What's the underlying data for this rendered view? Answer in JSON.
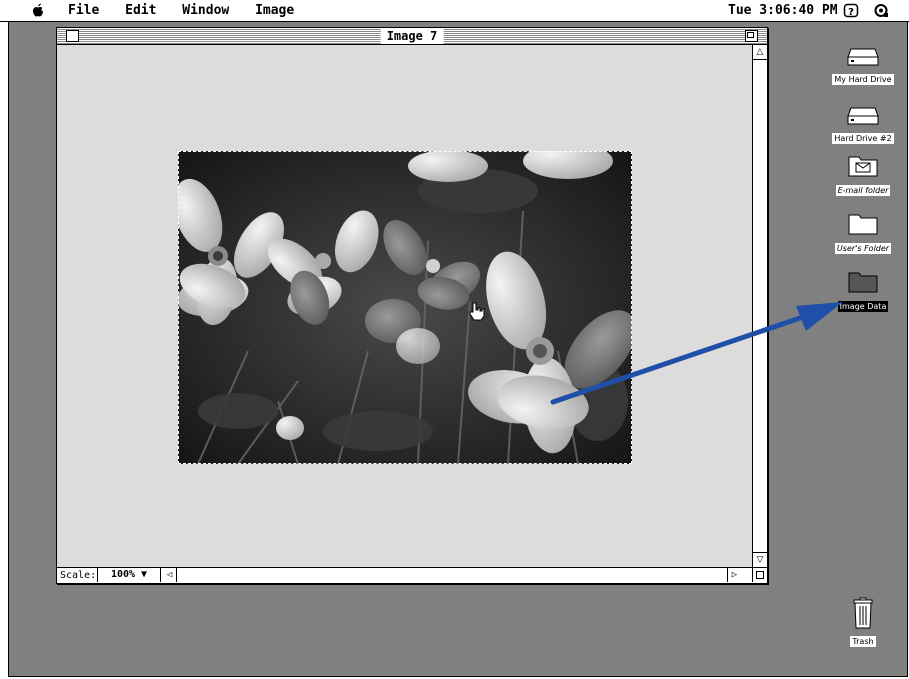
{
  "menubar": {
    "menus": [
      "File",
      "Edit",
      "Window",
      "Image"
    ],
    "clock": "Tue 3:06:40 PM"
  },
  "window": {
    "title": "Image 7",
    "scale_label": "Scale:",
    "scale_value": "100% ▼"
  },
  "desktop": {
    "icons": [
      {
        "label": "My Hard Drive",
        "icon": "hard-drive-icon"
      },
      {
        "label": "Hard Drive #2",
        "icon": "hard-drive-icon"
      },
      {
        "label": "E-mail folder",
        "icon": "email-folder-icon"
      },
      {
        "label": "User's Folder",
        "icon": "folder-icon"
      },
      {
        "label": "Image Data",
        "icon": "folder-icon"
      },
      {
        "label": "Trash",
        "icon": "trash-icon"
      }
    ]
  },
  "colors": {
    "desktop": "#808080",
    "window_content": "#dcdcdc",
    "annotation_arrow": "#1f4fa8"
  }
}
